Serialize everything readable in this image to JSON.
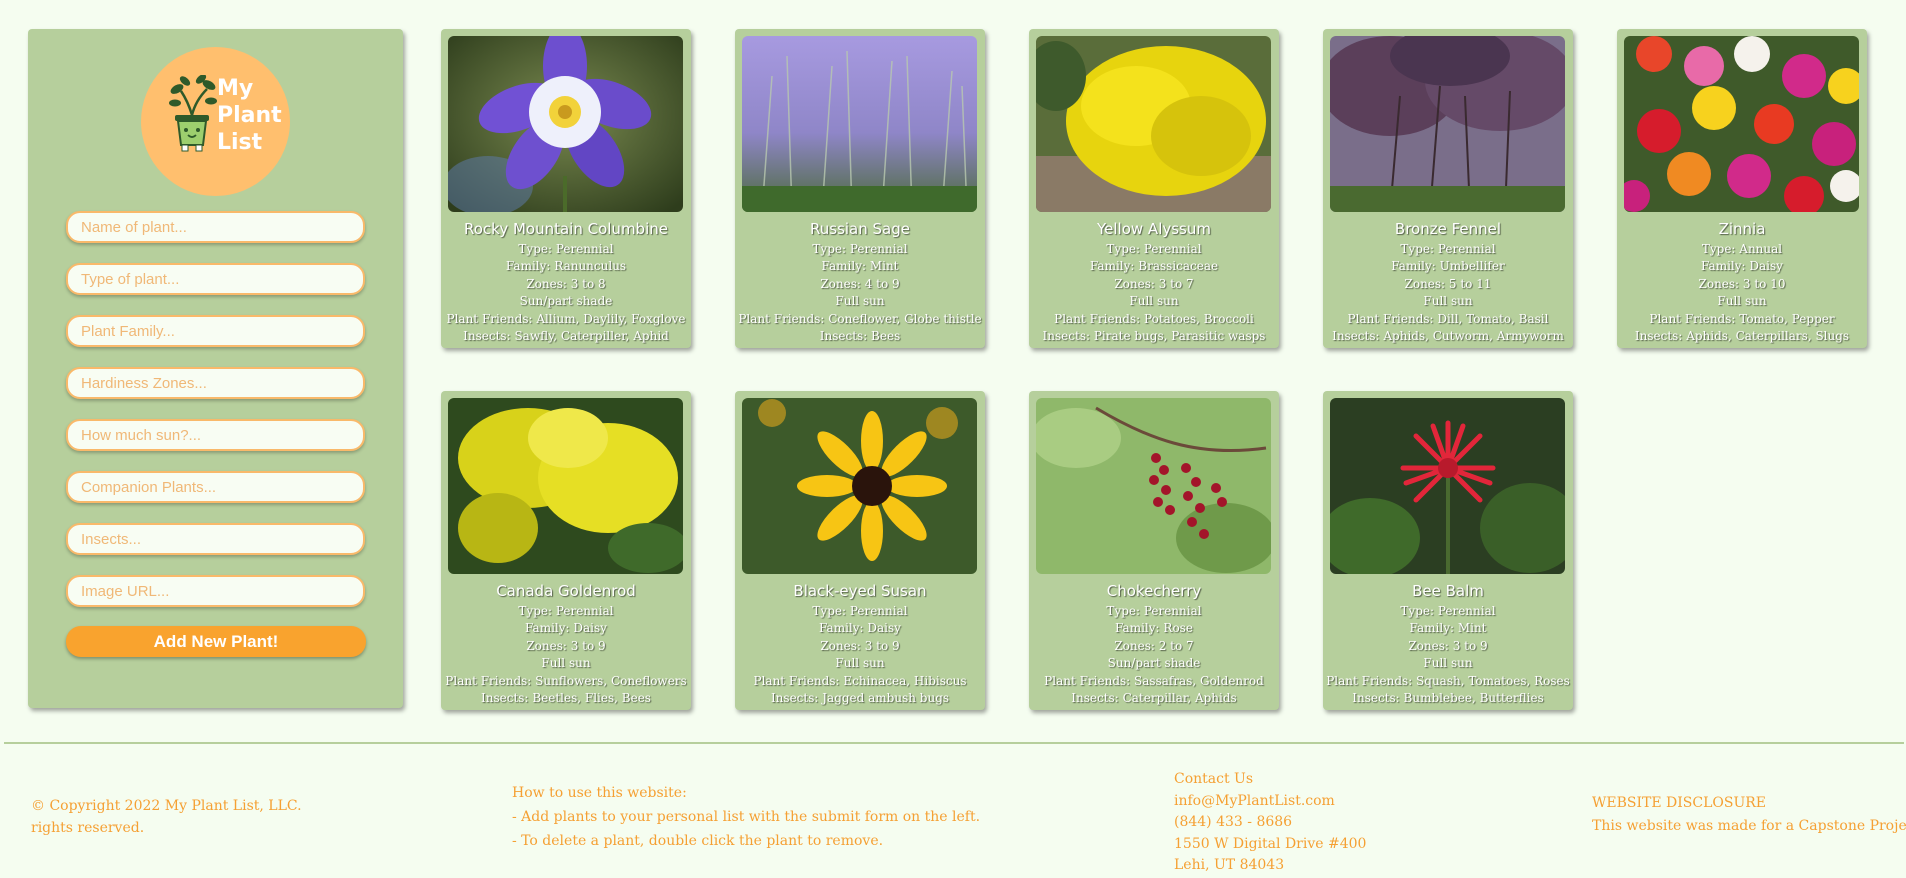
{
  "sidebar": {
    "logo_text": [
      "My",
      "Plant",
      "List"
    ],
    "placeholders": {
      "name": "Name of plant...",
      "type": "Type of plant...",
      "family": "Plant Family...",
      "zones": "Hardiness Zones...",
      "sun": "How much sun?...",
      "companions": "Companion Plants...",
      "insects": "Insects...",
      "image": "Image URL..."
    },
    "add_button": "Add New Plant!"
  },
  "plants": [
    {
      "name": "Rocky Mountain Columbine",
      "type": "Type: Perennial",
      "family": "Family: Ranunculus",
      "zones": "Zones: 3 to 8",
      "sun": "Sun/part shade",
      "friends": "Plant Friends: Allium, Daylily, Foxglove",
      "insects": "Insects: Sawfly, Caterpiller, Aphid"
    },
    {
      "name": "Russian Sage",
      "type": "Type: Perennial",
      "family": "Family: Mint",
      "zones": "Zones: 4 to 9",
      "sun": "Full sun",
      "friends": "Plant Friends: Coneflower, Globe thistle",
      "insects": "Insects: Bees"
    },
    {
      "name": "Yellow Alyssum",
      "type": "Type: Perennial",
      "family": "Family: Brassicaceae",
      "zones": "Zones: 3 to 7",
      "sun": "Full sun",
      "friends": "Plant Friends: Potatoes, Broccoli",
      "insects": "Insects: Pirate bugs, Parasitic wasps"
    },
    {
      "name": "Bronze Fennel",
      "type": "Type: Perennial",
      "family": "Family: Umbellifer",
      "zones": "Zones: 5 to 11",
      "sun": "Full sun",
      "friends": "Plant Friends: Dill, Tomato, Basil",
      "insects": "Insects: Aphids, Cutworm, Armyworm"
    },
    {
      "name": "Zinnia",
      "type": "Type: Annual",
      "family": "Family: Daisy",
      "zones": "Zones: 3 to 10",
      "sun": "Full sun",
      "friends": "Plant Friends: Tomato, Pepper",
      "insects": "Insects: Aphids, Caterpillars, Slugs"
    },
    {
      "name": "Canada Goldenrod",
      "type": "Type: Perennial",
      "family": "Family: Daisy",
      "zones": "Zones: 3 to 9",
      "sun": "Full sun",
      "friends": "Plant Friends: Sunflowers, Coneflowers",
      "insects": "Insects: Beetles, Flies, Bees"
    },
    {
      "name": "Black-eyed Susan",
      "type": "Type: Perennial",
      "family": "Family: Daisy",
      "zones": "Zones: 3 to 9",
      "sun": "Full sun",
      "friends": "Plant Friends: Echinacea, Hibiscus",
      "insects": "Insects: Jagged ambush bugs"
    },
    {
      "name": "Chokecherry",
      "type": "Type: Perennial",
      "family": "Family: Rose",
      "zones": "Zones: 2 to 7",
      "sun": "Sun/part shade",
      "friends": "Plant Friends: Sassafras, Goldenrod",
      "insects": "Insects: Caterpillar, Aphids"
    },
    {
      "name": "Bee Balm",
      "type": "Type: Perennial",
      "family": "Family: Mint",
      "zones": "Zones: 3 to 9",
      "sun": "Full sun",
      "friends": "Plant Friends: Squash, Tomatoes, Roses",
      "insects": "Insects: Bumblebee, Butterflies"
    }
  ],
  "footer": {
    "copyright": [
      "© Copyright 2022 My Plant List, LLC.",
      "rights reserved."
    ],
    "howto": [
      "How to use this website:",
      "- Add plants to your personal list with the submit form on the left.",
      "- To delete a plant, double click the plant to remove."
    ],
    "contact": [
      "Contact Us",
      "info@MyPlantList.com",
      "(844) 433 - 8686",
      "1550 W Digital Drive #400",
      "Lehi, UT 84043"
    ],
    "disclosure": [
      "WEBSITE DISCLOSURE",
      "This website was made for a Capstone Project"
    ]
  },
  "colors": {
    "accent": "#f9a32e",
    "card": "#b6cf9c",
    "background": "#f5fdf0",
    "logo": "#ffbf6e"
  }
}
